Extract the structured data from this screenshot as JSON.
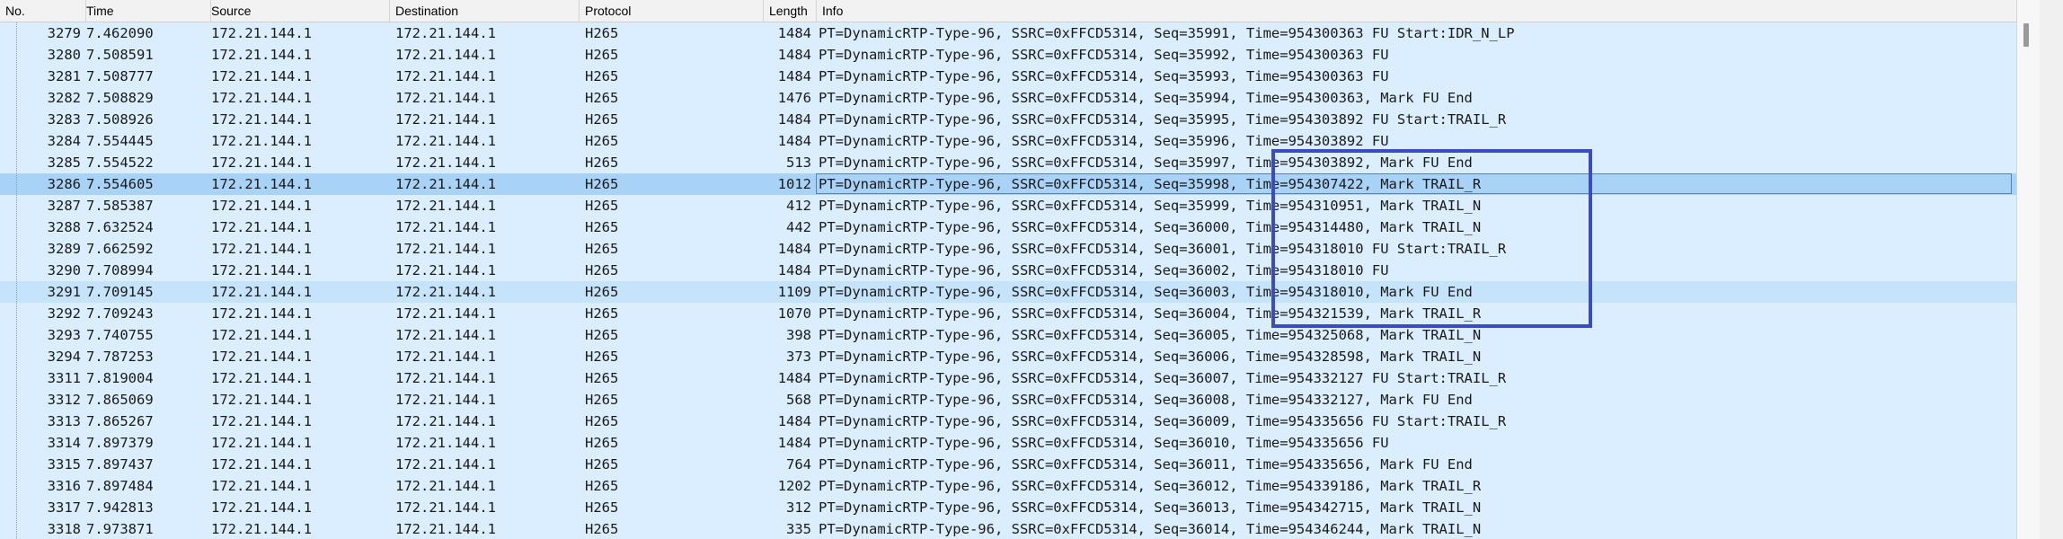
{
  "columns": {
    "no": "No.",
    "time": "Time",
    "source": "Source",
    "destination": "Destination",
    "protocol": "Protocol",
    "length": "Length",
    "info": "Info"
  },
  "packets": [
    {
      "no": "3279",
      "time": "7.462090",
      "source": "172.21.144.1",
      "destination": "172.21.144.1",
      "protocol": "H265",
      "length": "1484",
      "info": "PT=DynamicRTP-Type-96, SSRC=0xFFCD5314, Seq=35991, Time=954300363 FU Start:IDR_N_LP",
      "state": "normal"
    },
    {
      "no": "3280",
      "time": "7.508591",
      "source": "172.21.144.1",
      "destination": "172.21.144.1",
      "protocol": "H265",
      "length": "1484",
      "info": "PT=DynamicRTP-Type-96, SSRC=0xFFCD5314, Seq=35992, Time=954300363 FU",
      "state": "normal"
    },
    {
      "no": "3281",
      "time": "7.508777",
      "source": "172.21.144.1",
      "destination": "172.21.144.1",
      "protocol": "H265",
      "length": "1484",
      "info": "PT=DynamicRTP-Type-96, SSRC=0xFFCD5314, Seq=35993, Time=954300363 FU",
      "state": "normal"
    },
    {
      "no": "3282",
      "time": "7.508829",
      "source": "172.21.144.1",
      "destination": "172.21.144.1",
      "protocol": "H265",
      "length": "1476",
      "info": "PT=DynamicRTP-Type-96, SSRC=0xFFCD5314, Seq=35994, Time=954300363, Mark FU End",
      "state": "normal"
    },
    {
      "no": "3283",
      "time": "7.508926",
      "source": "172.21.144.1",
      "destination": "172.21.144.1",
      "protocol": "H265",
      "length": "1484",
      "info": "PT=DynamicRTP-Type-96, SSRC=0xFFCD5314, Seq=35995, Time=954303892 FU Start:TRAIL_R",
      "state": "normal"
    },
    {
      "no": "3284",
      "time": "7.554445",
      "source": "172.21.144.1",
      "destination": "172.21.144.1",
      "protocol": "H265",
      "length": "1484",
      "info": "PT=DynamicRTP-Type-96, SSRC=0xFFCD5314, Seq=35996, Time=954303892 FU",
      "state": "normal"
    },
    {
      "no": "3285",
      "time": "7.554522",
      "source": "172.21.144.1",
      "destination": "172.21.144.1",
      "protocol": "H265",
      "length": "513",
      "info": "PT=DynamicRTP-Type-96, SSRC=0xFFCD5314, Seq=35997, Time=954303892, Mark FU End",
      "state": "normal"
    },
    {
      "no": "3286",
      "time": "7.554605",
      "source": "172.21.144.1",
      "destination": "172.21.144.1",
      "protocol": "H265",
      "length": "1012",
      "info": "PT=DynamicRTP-Type-96, SSRC=0xFFCD5314, Seq=35998, Time=954307422, Mark TRAIL_R",
      "state": "selected"
    },
    {
      "no": "3287",
      "time": "7.585387",
      "source": "172.21.144.1",
      "destination": "172.21.144.1",
      "protocol": "H265",
      "length": "412",
      "info": "PT=DynamicRTP-Type-96, SSRC=0xFFCD5314, Seq=35999, Time=954310951, Mark TRAIL_N",
      "state": "normal"
    },
    {
      "no": "3288",
      "time": "7.632524",
      "source": "172.21.144.1",
      "destination": "172.21.144.1",
      "protocol": "H265",
      "length": "442",
      "info": "PT=DynamicRTP-Type-96, SSRC=0xFFCD5314, Seq=36000, Time=954314480, Mark TRAIL_N",
      "state": "normal"
    },
    {
      "no": "3289",
      "time": "7.662592",
      "source": "172.21.144.1",
      "destination": "172.21.144.1",
      "protocol": "H265",
      "length": "1484",
      "info": "PT=DynamicRTP-Type-96, SSRC=0xFFCD5314, Seq=36001, Time=954318010 FU Start:TRAIL_R",
      "state": "normal"
    },
    {
      "no": "3290",
      "time": "7.708994",
      "source": "172.21.144.1",
      "destination": "172.21.144.1",
      "protocol": "H265",
      "length": "1484",
      "info": "PT=DynamicRTP-Type-96, SSRC=0xFFCD5314, Seq=36002, Time=954318010 FU",
      "state": "normal"
    },
    {
      "no": "3291",
      "time": "7.709145",
      "source": "172.21.144.1",
      "destination": "172.21.144.1",
      "protocol": "H265",
      "length": "1109",
      "info": "PT=DynamicRTP-Type-96, SSRC=0xFFCD5314, Seq=36003, Time=954318010, Mark FU End",
      "state": "related"
    },
    {
      "no": "3292",
      "time": "7.709243",
      "source": "172.21.144.1",
      "destination": "172.21.144.1",
      "protocol": "H265",
      "length": "1070",
      "info": "PT=DynamicRTP-Type-96, SSRC=0xFFCD5314, Seq=36004, Time=954321539, Mark TRAIL_R",
      "state": "normal"
    },
    {
      "no": "3293",
      "time": "7.740755",
      "source": "172.21.144.1",
      "destination": "172.21.144.1",
      "protocol": "H265",
      "length": "398",
      "info": "PT=DynamicRTP-Type-96, SSRC=0xFFCD5314, Seq=36005, Time=954325068, Mark TRAIL_N",
      "state": "normal"
    },
    {
      "no": "3294",
      "time": "7.787253",
      "source": "172.21.144.1",
      "destination": "172.21.144.1",
      "protocol": "H265",
      "length": "373",
      "info": "PT=DynamicRTP-Type-96, SSRC=0xFFCD5314, Seq=36006, Time=954328598, Mark TRAIL_N",
      "state": "normal"
    },
    {
      "no": "3311",
      "time": "7.819004",
      "source": "172.21.144.1",
      "destination": "172.21.144.1",
      "protocol": "H265",
      "length": "1484",
      "info": "PT=DynamicRTP-Type-96, SSRC=0xFFCD5314, Seq=36007, Time=954332127 FU Start:TRAIL_R",
      "state": "normal"
    },
    {
      "no": "3312",
      "time": "7.865069",
      "source": "172.21.144.1",
      "destination": "172.21.144.1",
      "protocol": "H265",
      "length": "568",
      "info": "PT=DynamicRTP-Type-96, SSRC=0xFFCD5314, Seq=36008, Time=954332127, Mark FU End",
      "state": "normal"
    },
    {
      "no": "3313",
      "time": "7.865267",
      "source": "172.21.144.1",
      "destination": "172.21.144.1",
      "protocol": "H265",
      "length": "1484",
      "info": "PT=DynamicRTP-Type-96, SSRC=0xFFCD5314, Seq=36009, Time=954335656 FU Start:TRAIL_R",
      "state": "normal"
    },
    {
      "no": "3314",
      "time": "7.897379",
      "source": "172.21.144.1",
      "destination": "172.21.144.1",
      "protocol": "H265",
      "length": "1484",
      "info": "PT=DynamicRTP-Type-96, SSRC=0xFFCD5314, Seq=36010, Time=954335656 FU",
      "state": "normal"
    },
    {
      "no": "3315",
      "time": "7.897437",
      "source": "172.21.144.1",
      "destination": "172.21.144.1",
      "protocol": "H265",
      "length": "764",
      "info": "PT=DynamicRTP-Type-96, SSRC=0xFFCD5314, Seq=36011, Time=954335656, Mark FU End",
      "state": "normal"
    },
    {
      "no": "3316",
      "time": "7.897484",
      "source": "172.21.144.1",
      "destination": "172.21.144.1",
      "protocol": "H265",
      "length": "1202",
      "info": "PT=DynamicRTP-Type-96, SSRC=0xFFCD5314, Seq=36012, Time=954339186, Mark TRAIL_R",
      "state": "normal"
    },
    {
      "no": "3317",
      "time": "7.942813",
      "source": "172.21.144.1",
      "destination": "172.21.144.1",
      "protocol": "H265",
      "length": "312",
      "info": "PT=DynamicRTP-Type-96, SSRC=0xFFCD5314, Seq=36013, Time=954342715, Mark TRAIL_N",
      "state": "normal"
    },
    {
      "no": "3318",
      "time": "7.973871",
      "source": "172.21.144.1",
      "destination": "172.21.144.1",
      "protocol": "H265",
      "length": "335",
      "info": "PT=DynamicRTP-Type-96, SSRC=0xFFCD5314, Seq=36014, Time=954346244, Mark TRAIL_N",
      "state": "normal"
    }
  ],
  "colors": {
    "row_bg": "#dbeeff",
    "selected_bg": "#a9d2f7",
    "related_bg": "#c5e4fb",
    "annotation_box": "#3a4bc4"
  }
}
